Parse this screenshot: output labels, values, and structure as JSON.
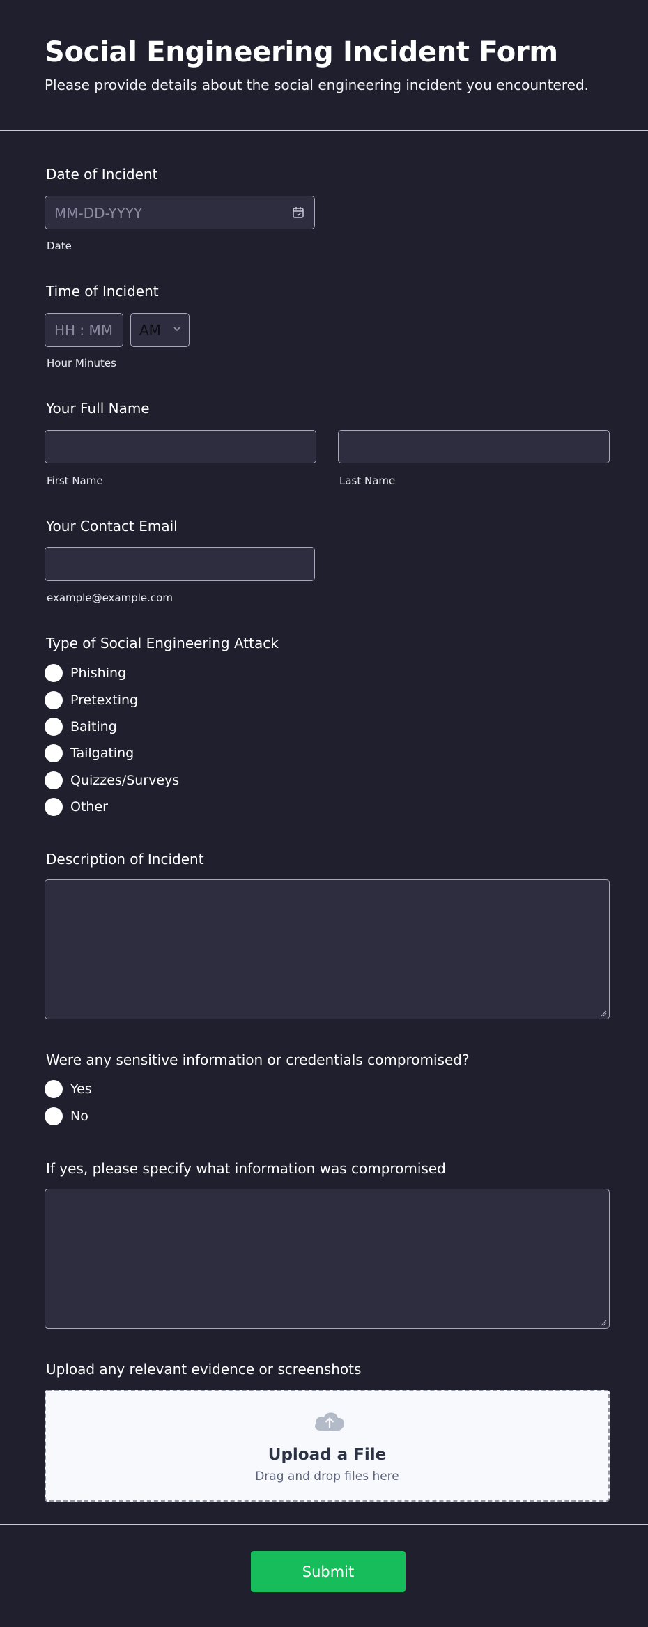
{
  "header": {
    "title": "Social Engineering Incident Form",
    "subtitle": "Please provide details about the social engineering incident you encountered."
  },
  "date_of_incident": {
    "label": "Date of Incident",
    "placeholder": "MM-DD-YYYY",
    "sublabel": "Date",
    "icon": "calendar-icon"
  },
  "time_of_incident": {
    "label": "Time of Incident",
    "placeholder": "HH : MM",
    "ampm_value": "AM",
    "sublabel": "Hour Minutes"
  },
  "full_name": {
    "label": "Your Full Name",
    "first_sublabel": "First Name",
    "last_sublabel": "Last Name"
  },
  "contact_email": {
    "label": "Your Contact Email",
    "sublabel": "example@example.com"
  },
  "attack_type": {
    "label": "Type of Social Engineering Attack",
    "options": [
      "Phishing",
      "Pretexting",
      "Baiting",
      "Tailgating",
      "Quizzes/Surveys",
      "Other"
    ]
  },
  "description": {
    "label": "Description of Incident"
  },
  "compromised": {
    "label": "Were any sensitive information or credentials compromised?",
    "options": [
      "Yes",
      "No"
    ]
  },
  "compromised_details": {
    "label": "If yes, please specify what information was compromised"
  },
  "upload": {
    "label": "Upload any relevant evidence or screenshots",
    "title": "Upload a File",
    "subtitle": "Drag and drop files here",
    "icon": "cloud-upload-icon"
  },
  "submit": {
    "label": "Submit",
    "color": "#18bd5b"
  },
  "colors": {
    "background": "#1f1f2e",
    "field_background": "#2d2d3f"
  }
}
